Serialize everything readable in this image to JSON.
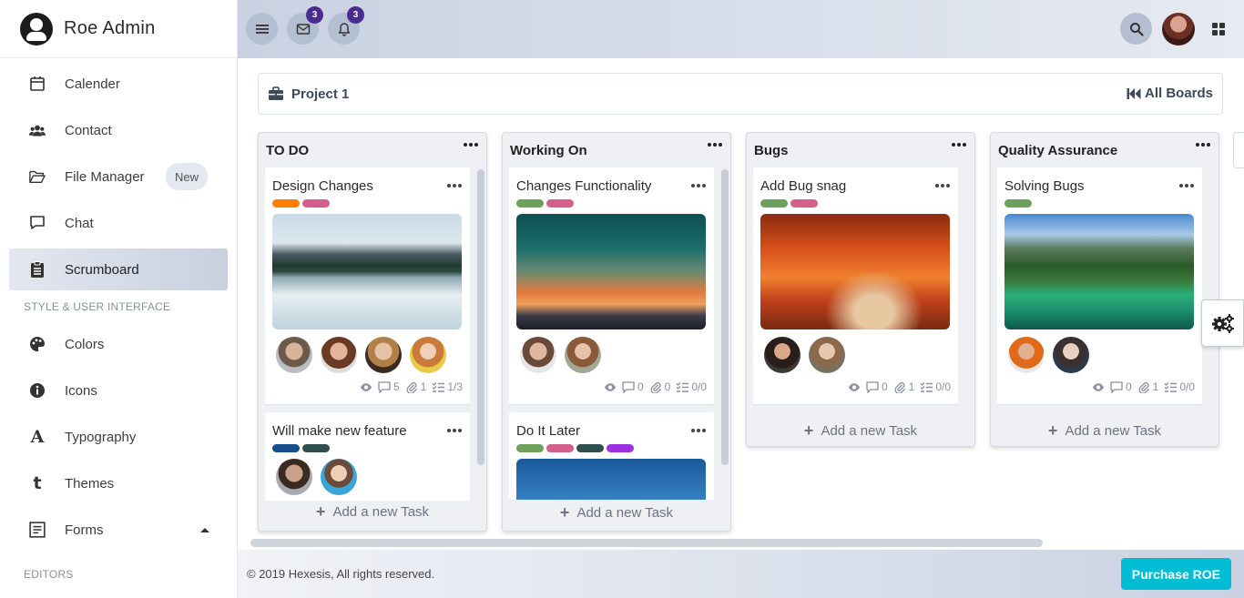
{
  "brand": {
    "name": "Roe Admin"
  },
  "sidebar": {
    "items": [
      {
        "label": "Calender",
        "icon": "calendar-icon"
      },
      {
        "label": "Contact",
        "icon": "users-icon"
      },
      {
        "label": "File Manager",
        "icon": "folder-open-icon",
        "badge": "New"
      },
      {
        "label": "Chat",
        "icon": "chat-bubble-icon"
      },
      {
        "label": "Scrumboard",
        "icon": "clipboard-icon",
        "active": true
      }
    ],
    "section_style": "STYLE & USER INTERFACE",
    "style_items": [
      {
        "label": "Colors",
        "icon": "palette-icon"
      },
      {
        "label": "Icons",
        "icon": "info-circle-icon"
      },
      {
        "label": "Typography",
        "icon": "font-icon"
      },
      {
        "label": "Themes",
        "icon": "tumblr-icon"
      },
      {
        "label": "Forms",
        "icon": "form-icon"
      }
    ],
    "section_editors": "EDITORS"
  },
  "topbar": {
    "mail_count": "3",
    "bell_count": "3"
  },
  "project": {
    "title": "Project 1",
    "all_boards": "All Boards"
  },
  "board": {
    "add_task": "Add a new Task",
    "lists": [
      {
        "title": "TO DO",
        "cards": [
          {
            "title": "Design Changes",
            "views": "",
            "comments": "5",
            "attachments": "1",
            "checklist": "1/3"
          },
          {
            "title": "Will make new feature"
          }
        ]
      },
      {
        "title": "Working On",
        "cards": [
          {
            "title": "Changes Functionality",
            "comments": "0",
            "attachments": "0",
            "checklist": "0/0"
          },
          {
            "title": "Do It Later"
          }
        ]
      },
      {
        "title": "Bugs",
        "cards": [
          {
            "title": "Add Bug snag",
            "comments": "0",
            "attachments": "1",
            "checklist": "0/0"
          }
        ]
      },
      {
        "title": "Quality Assurance",
        "cards": [
          {
            "title": "Solving Bugs",
            "comments": "0",
            "attachments": "1",
            "checklist": "0/0"
          }
        ]
      }
    ]
  },
  "colors": {
    "orange": "#ff7f00",
    "pink": "#d45f8a",
    "green": "#6ea15c",
    "navy": "#1a4e8a",
    "darkteal": "#2f4f4f",
    "purple": "#9b30e0",
    "accent": "#00bcd4"
  },
  "footer": {
    "copyright": "© 2019 Hexesis, All rights reserved.",
    "purchase": "Purchase ROE"
  }
}
